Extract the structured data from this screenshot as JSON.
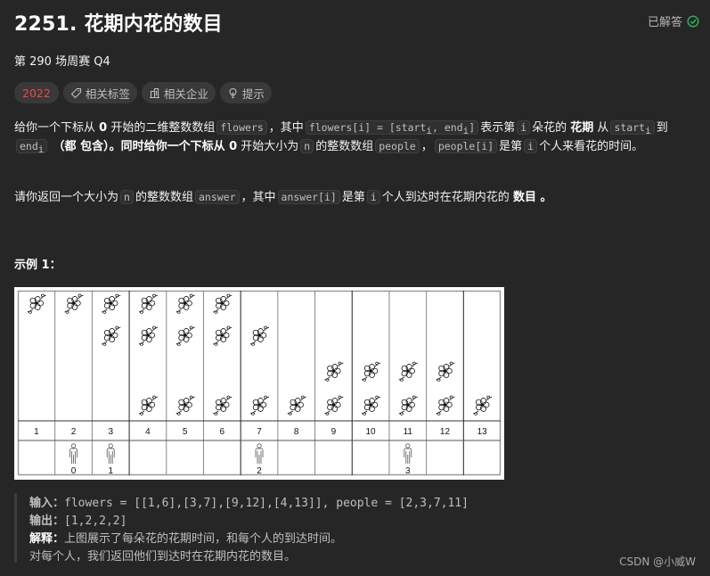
{
  "header": {
    "title": "2251. 花期内花的数目",
    "status_label": "已解答",
    "status_color": "#2db55d"
  },
  "contest": "第 290 场周赛 Q4",
  "tags": [
    {
      "label": "2022",
      "icon": "",
      "color": "#ef4743"
    },
    {
      "label": "相关标签",
      "icon": "tag-icon"
    },
    {
      "label": "相关企业",
      "icon": "building-icon"
    },
    {
      "label": "提示",
      "icon": "lightbulb-icon"
    }
  ],
  "description": {
    "p1": {
      "t1": "给你一个下标从 ",
      "b1": "0",
      "t2": " 开始的二维整数数组",
      "c1": "flowers",
      "t3": "，其中",
      "c2a": "flowers[i] = [start",
      "c2b": "i",
      "c2c": ", end",
      "c2d": "i",
      "c2e": "]",
      "t4": "表示第",
      "c3": "i",
      "t5": "朵花的 ",
      "b2": "花期",
      "t6": " 从",
      "c4a": "start",
      "c4b": "i",
      "t7": "到",
      "c5a": "end",
      "c5b": "i",
      "b3": "（都 包含）",
      "t8": "。同时给你一个下标从 ",
      "b4": "0",
      "t9": " 开始大小为",
      "c6": "n",
      "t10": "的整数数组",
      "c7": "people",
      "t11": "，",
      "c8": "people[i]",
      "t12": "是第",
      "c9": "i",
      "t13": "个人来看花的时间。"
    },
    "p2": {
      "t1": "请你返回一个大小为",
      "c1": "n",
      "t2": "的整数数组",
      "c2": "answer",
      "t3": "，其中",
      "c3": "answer[i]",
      "t4": "是第",
      "c4": "i",
      "t5": "个人到达时在花期内花的 ",
      "b1": "数目",
      "t6": " 。"
    }
  },
  "example": {
    "title": "示例 1：",
    "figure": {
      "days": [
        "1",
        "2",
        "3",
        "4",
        "5",
        "6",
        "7",
        "8",
        "9",
        "10",
        "11",
        "12",
        "13"
      ],
      "flowers": [
        [
          1,
          6
        ],
        [
          3,
          7
        ],
        [
          9,
          12
        ],
        [
          4,
          13
        ]
      ],
      "people": [
        {
          "day": 2,
          "label": "0"
        },
        {
          "day": 3,
          "label": "1"
        },
        {
          "day": 7,
          "label": "2"
        },
        {
          "day": 11,
          "label": "3"
        }
      ]
    },
    "input_label": "输入：",
    "input_value": "flowers = [[1,6],[3,7],[9,12],[4,13]], people = [2,3,7,11]",
    "output_label": "输出：",
    "output_value": "[1,2,2,2]",
    "explain_label": "解释：",
    "explain_text": "上图展示了每朵花的花期时间，和每个人的到达时间。",
    "explain_text2": "对每个人，我们返回他们到达时在花期内花的数目。"
  },
  "watermark": "CSDN @小威W"
}
